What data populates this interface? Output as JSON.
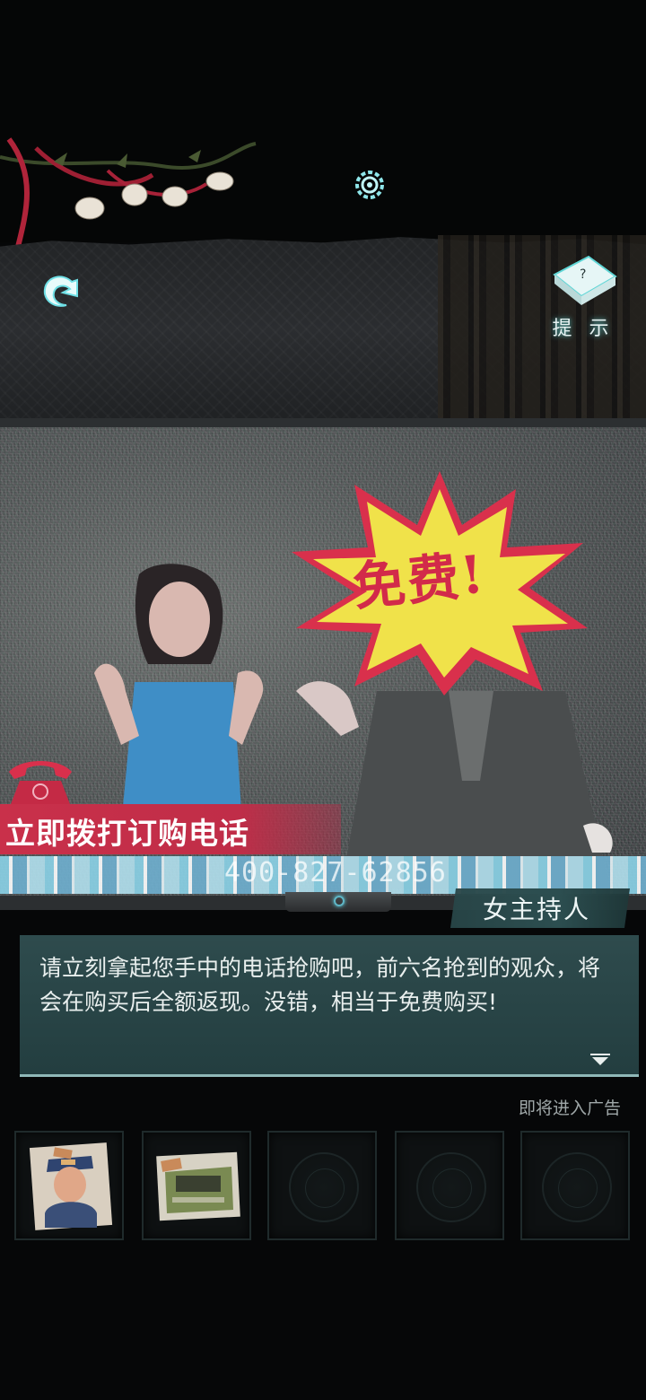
{
  "header": {
    "hint_label": "提 示"
  },
  "tv": {
    "starburst_text": "免费!",
    "order_banner": "立即拨打订购电话",
    "phone_number": "400-827-62856"
  },
  "dialog": {
    "speaker": "女主持人",
    "text": "请立刻拿起您手中的电话抢购吧，前六名抢到的观众，将会在购买后全额返现。没错，相当于免费购买!"
  },
  "ad_notice": "即将进入广告",
  "inventory": {
    "slots": [
      {
        "icon": "conductor-portrait-icon",
        "filled": true
      },
      {
        "icon": "green-vehicle-icon",
        "filled": true
      },
      {
        "icon": "empty-slot-emblem",
        "filled": false
      },
      {
        "icon": "empty-slot-emblem",
        "filled": false
      },
      {
        "icon": "empty-slot-emblem",
        "filled": false
      }
    ]
  },
  "colors": {
    "accent_glow": "#5fd6d6",
    "banner_red": "#c9304a",
    "starburst_yellow": "#f0e24a",
    "dialog_teal": "#2f5052"
  }
}
